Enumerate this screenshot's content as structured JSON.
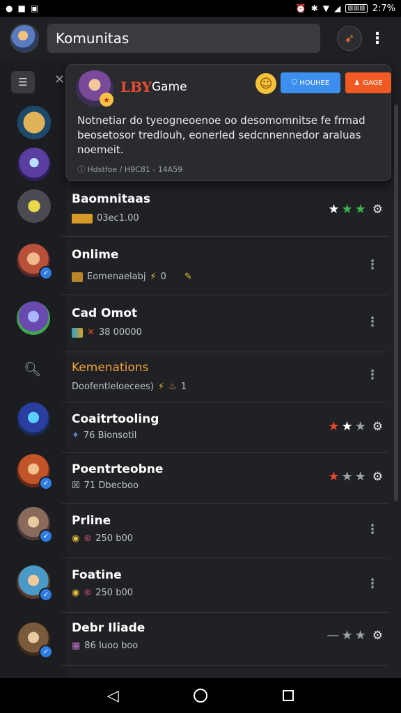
{
  "status_bar": {
    "left_icons": [
      "notification-icon",
      "app-icon",
      "image-icon"
    ],
    "right_text": "2:7%",
    "battery_label": "▥▥▥",
    "icons": [
      "alarm-icon",
      "bluetooth-icon",
      "wifi-icon",
      "signal-icon"
    ]
  },
  "appbar": {
    "search_value": "Komunitas"
  },
  "popup": {
    "brand": "LBY",
    "game": "Game",
    "primary_button": "HOUHEE",
    "secondary_button": "GAGE",
    "description": "Notnetiar do tyeogneoenoe oo desomomnitse fe frmad beosetosor tredlouh, eonerled sedcnnennedor araluas noemeit.",
    "meta": "ⓘ Hdstfoe / H9C81 - 14A59"
  },
  "list": [
    {
      "title": "Baomnitaas",
      "sub": "03ec1.00",
      "trailing": "stars",
      "stars": [
        "white",
        "green",
        "green"
      ]
    },
    {
      "title": "Onlime",
      "sub": "Eomenaelabj",
      "count": "0",
      "trailing": "more"
    },
    {
      "title": "Cad Omot",
      "sub": "38 00000",
      "trailing": "more"
    },
    {
      "title": "Kemenations",
      "sub": "Doofentleloecees)",
      "count": "1",
      "trailing": "more",
      "highlight": true
    },
    {
      "title": "Coaitrtooling",
      "sub": "76 Bionsotil",
      "trailing": "stars",
      "stars": [
        "red",
        "white",
        "grey"
      ]
    },
    {
      "title": "Poentrteobne",
      "sub": "71 Dbecboo",
      "trailing": "stars",
      "stars": [
        "red",
        "grey",
        "grey"
      ]
    },
    {
      "title": "Prline",
      "sub": "250 b00",
      "trailing": "more"
    },
    {
      "title": "Foatine",
      "sub": "250 b00",
      "trailing": "more"
    },
    {
      "title": "Debr Iliade",
      "sub": "86 Iuoo boo",
      "trailing": "stars",
      "stars": [
        "grey",
        "grey",
        "grey"
      ]
    }
  ],
  "colors": {
    "accent_blue": "#3d8fef",
    "accent_orange": "#f25a24",
    "highlight_orange": "#f0a23a",
    "background": "#202124"
  }
}
